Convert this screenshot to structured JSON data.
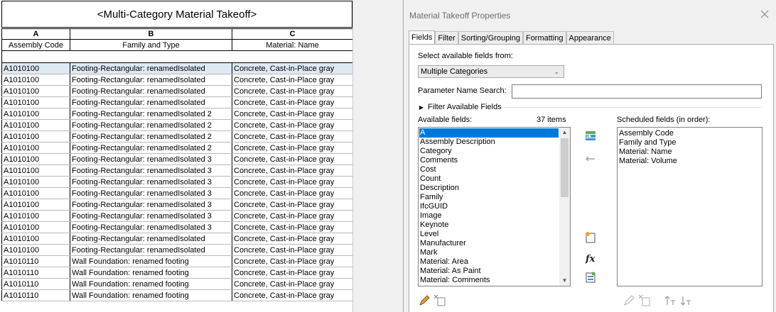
{
  "schedule": {
    "title": "<Multi-Category Material Takeoff>",
    "column_letters": [
      "A",
      "B",
      "C"
    ],
    "column_headers": [
      "Assembly Code",
      "Family and Type",
      "Material: Name"
    ],
    "rows": [
      [
        "A1010100",
        "Footing-Rectangular: renamedIsolated",
        "Concrete, Cast-in-Place gray"
      ],
      [
        "A1010100",
        "Footing-Rectangular: renamedIsolated",
        "Concrete, Cast-in-Place gray"
      ],
      [
        "A1010100",
        "Footing-Rectangular: renamedIsolated",
        "Concrete, Cast-in-Place gray"
      ],
      [
        "A1010100",
        "Footing-Rectangular: renamedIsolated",
        "Concrete, Cast-in-Place gray"
      ],
      [
        "A1010100",
        "Footing-Rectangular: renamedIsolated 2",
        "Concrete, Cast-in-Place gray"
      ],
      [
        "A1010100",
        "Footing-Rectangular: renamedIsolated 2",
        "Concrete, Cast-in-Place gray"
      ],
      [
        "A1010100",
        "Footing-Rectangular: renamedIsolated 2",
        "Concrete, Cast-in-Place gray"
      ],
      [
        "A1010100",
        "Footing-Rectangular: renamedIsolated 2",
        "Concrete, Cast-in-Place gray"
      ],
      [
        "A1010100",
        "Footing-Rectangular: renamedIsolated 3",
        "Concrete, Cast-in-Place gray"
      ],
      [
        "A1010100",
        "Footing-Rectangular: renamedIsolated 3",
        "Concrete, Cast-in-Place gray"
      ],
      [
        "A1010100",
        "Footing-Rectangular: renamedIsolated 3",
        "Concrete, Cast-in-Place gray"
      ],
      [
        "A1010100",
        "Footing-Rectangular: renamedIsolated 3",
        "Concrete, Cast-in-Place gray"
      ],
      [
        "A1010100",
        "Footing-Rectangular: renamedIsolated 3",
        "Concrete, Cast-in-Place gray"
      ],
      [
        "A1010100",
        "Footing-Rectangular: renamedIsolated 3",
        "Concrete, Cast-in-Place gray"
      ],
      [
        "A1010100",
        "Footing-Rectangular: renamedIsolated 3",
        "Concrete, Cast-in-Place gray"
      ],
      [
        "A1010100",
        "Footing-Rectangular: renamedIsolated",
        "Concrete, Cast-in-Place gray"
      ],
      [
        "A1010100",
        "Footing-Rectangular: renamedIsolated",
        "Concrete, Cast-in-Place gray"
      ],
      [
        "A1010110",
        "Wall Foundation: renamed footing",
        "Concrete, Cast-in-Place gray"
      ],
      [
        "A1010110",
        "Wall Foundation: renamed footing",
        "Concrete, Cast-in-Place gray"
      ],
      [
        "A1010110",
        "Wall Foundation: renamed footing",
        "Concrete, Cast-in-Place gray"
      ],
      [
        "A1010110",
        "Wall Foundation: renamed footing",
        "Concrete, Cast-in-Place gray"
      ]
    ],
    "selected_row": 0
  },
  "dialog": {
    "title": "Material Takeoff Properties",
    "close_icon": "close-icon",
    "tabs": [
      {
        "label": "Fields",
        "active": true
      },
      {
        "label": "Filter",
        "active": false
      },
      {
        "label": "Sorting/Grouping",
        "active": false
      },
      {
        "label": "Formatting",
        "active": false
      },
      {
        "label": "Appearance",
        "active": false
      }
    ],
    "select_from_label": "Select available fields from:",
    "category_value": "Multiple Categories",
    "param_search_label": "Parameter Name Search:",
    "param_search_value": "",
    "filter_available_label": "Filter Available Fields",
    "available_label": "Available fields:",
    "available_count": "37 items",
    "available_fields": [
      "A",
      "Assembly Description",
      "Category",
      "Comments",
      "Cost",
      "Count",
      "Description",
      "Family",
      "IfcGUID",
      "Image",
      "Keynote",
      "Level",
      "Manufacturer",
      "Mark",
      "Material: Area",
      "Material: As Paint",
      "Material: Comments"
    ],
    "available_selected": 0,
    "scheduled_label": "Scheduled fields (in order):",
    "scheduled_fields": [
      "Assembly Code",
      "Family and Type",
      "Material: Name",
      "Material: Volume"
    ],
    "colors": {
      "selection": "#0078d7",
      "schedule_selected_row": "#dde9f5"
    }
  }
}
